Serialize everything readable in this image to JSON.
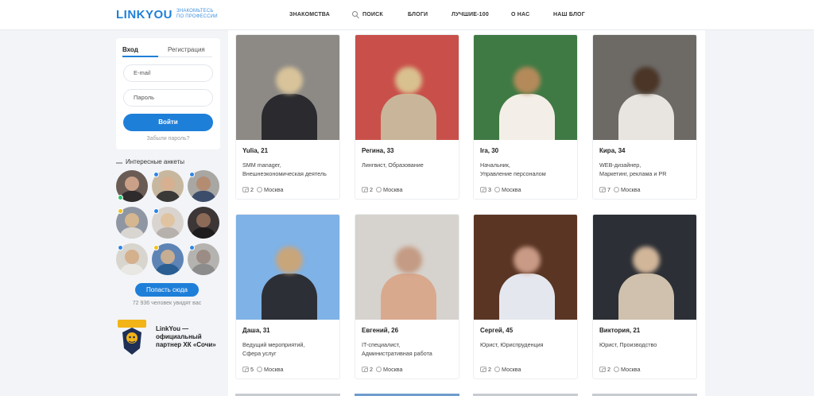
{
  "header": {
    "logo": "LINKYOU",
    "tagline_line1": "ЗНАКОМЬТЕСЬ",
    "tagline_line2": "ПО ПРОФЕССИИ",
    "nav": [
      "ЗНАКОМСТВА",
      "ПОИСК",
      "БЛОГИ",
      "ЛУЧШИЕ-100",
      "О НАС",
      "НАШ БЛОГ"
    ]
  },
  "login": {
    "tab_login": "Вход",
    "tab_register": "Регистрация",
    "email_placeholder": "E-mail",
    "password_placeholder": "Пароль",
    "submit": "Войти",
    "forgot": "Забыли пароль?"
  },
  "sidebar": {
    "interesting_title": "Интересные анкеты",
    "place_button": "Попасть сюда",
    "views_text": "72 936 человек увидят вас",
    "partner_text": "LinkYou — официальный партнер ХК «Сочи»",
    "partner_logo_text": "Сочи"
  },
  "profiles": [
    {
      "name": "Yulia, 21",
      "desc1": "SMM manager,",
      "desc2": "Внешнеэкономическая деятель",
      "photos": "2",
      "city": "Москва",
      "bg": "#8d8a86",
      "hair": "#d8c39a",
      "torso": "#2b2b2f"
    },
    {
      "name": "Регина, 33",
      "desc1": "Лингвист, Образование",
      "desc2": "",
      "photos": "2",
      "city": "Москва",
      "bg": "#c9504a",
      "hair": "#d9c08f",
      "torso": "#c8b59a"
    },
    {
      "name": "Ira, 30",
      "desc1": "Начальник,",
      "desc2": "Управление персоналом",
      "photos": "3",
      "city": "Москва",
      "bg": "#3f7a44",
      "hair": "#b58a5a",
      "torso": "#f3efe8"
    },
    {
      "name": "Кира, 34",
      "desc1": "WEB-дизайнер,",
      "desc2": "Маркетинг, реклама и PR",
      "photos": "7",
      "city": "Москва",
      "bg": "#6d6a66",
      "hair": "#4a3527",
      "torso": "#e8e4df"
    },
    {
      "name": "Даша, 31",
      "desc1": "Ведущий мероприятий,",
      "desc2": "Сфера услуг",
      "photos": "5",
      "city": "Москва",
      "bg": "#7fb2e6",
      "hair": "#c9a57a",
      "torso": "#2d2f36"
    },
    {
      "name": "Евгений, 26",
      "desc1": "IT-специалист,",
      "desc2": "Административная работа",
      "photos": "2",
      "city": "Москва",
      "bg": "#d6d2cd",
      "hair": "#c49b84",
      "torso": "#d9a98e"
    },
    {
      "name": "Сергей, 45",
      "desc1": "Юрист, Юриспруденция",
      "desc2": "",
      "photos": "2",
      "city": "Москва",
      "bg": "#5a3524",
      "hair": "#c99a85",
      "torso": "#e5e7ee"
    },
    {
      "name": "Виктория, 21",
      "desc1": "Юрист, Производство",
      "desc2": "",
      "photos": "2",
      "city": "Москва",
      "bg": "#2c2f35",
      "hair": "#d2b69a",
      "torso": "#cfc1ad"
    }
  ],
  "avatars": [
    {
      "bg": "#6a5c55",
      "face": "#caa088",
      "body": "#2f2b2c",
      "dot": "#27c26a"
    },
    {
      "bg": "#c7b79e",
      "face": "#d6b090",
      "body": "#3b3838",
      "dot": "#2d86e6"
    },
    {
      "bg": "#a8a7a3",
      "face": "#b38c72",
      "body": "#3c4d6b",
      "dot": "#2d86e6"
    },
    {
      "bg": "#8f96a3",
      "face": "#d4b690",
      "body": "#d9d6d2",
      "dot": "#f2c318"
    },
    {
      "bg": "#d9d4cf",
      "face": "#e0c4a2",
      "body": "#b7b1ad",
      "dot": "#2d86e6"
    },
    {
      "bg": "#3c3637",
      "face": "#8b6a57",
      "body": "#1f1c1d",
      "dot": ""
    },
    {
      "bg": "#d8d4ce",
      "face": "#d4b08d",
      "body": "#e9e7e3",
      "dot": "#2d86e6"
    },
    {
      "bg": "#5e84b5",
      "face": "#c7ad92",
      "body": "#2b5e92",
      "dot": "#f2c318"
    },
    {
      "bg": "#b5b3b0",
      "face": "#9b8d85",
      "body": "#8d8c8d",
      "dot": "#2d86e6"
    }
  ],
  "colors": {
    "accent": "#1e7fd9"
  }
}
